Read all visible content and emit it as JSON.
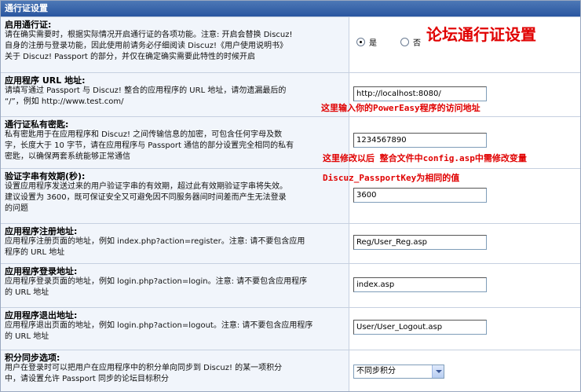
{
  "header": {
    "title": "通行证设置"
  },
  "rows": [
    {
      "title": "启用通行证:",
      "desc": [
        "请在确实需要时，根据实际情况开启通行证的各项功能。注意: 开启会替换 Discuz!",
        "自身的注册与登录功能，因此使用前请务必仔细阅读 Discuz!《用户使用说明书》",
        "关于 Discuz! Passport 的部分，并仅在确定确实需要此特性的时候开启"
      ],
      "options": [
        {
          "label": "是",
          "checked": true
        },
        {
          "label": "否",
          "checked": false
        }
      ]
    },
    {
      "title": "应用程序 URL 地址:",
      "desc": [
        "请填写通过 Passport 与 Discuz! 整合的应用程序的 URL 地址，请勿遗漏最后的",
        "“/”，例如 http://www.test.com/"
      ],
      "value": "http://localhost:8080/"
    },
    {
      "title": "通行证私有密匙:",
      "desc": [
        "私有密匙用于在应用程序和 Discuz! 之间传输信息的加密，可包含任何字母及数",
        "字，长度大于 10 字节，请在应用程序与 Passport 通信的部分设置完全相同的私有",
        "密匙，以确保两套系统能够正常通信"
      ],
      "value": "1234567890"
    },
    {
      "title": "验证字串有效期(秒):",
      "desc": [
        "设置应用程序发送过来的用户验证字串的有效期，超过此有效期验证字串将失效。",
        "建议设置为 3600，既可保证安全又可避免因不同服务器间时间差而产生无法登录",
        "的问题"
      ],
      "value": "3600"
    },
    {
      "title": "应用程序注册地址:",
      "desc": [
        "应用程序注册页面的地址，例如 index.php?action=register。注意: 请不要包含应用",
        "程序的 URL 地址"
      ],
      "value": "Reg/User_Reg.asp"
    },
    {
      "title": "应用程序登录地址:",
      "desc": [
        "应用程序登录页面的地址，例如 login.php?action=login。注意: 请不要包含应用程序",
        "的 URL 地址"
      ],
      "value": "index.asp"
    },
    {
      "title": "应用程序退出地址:",
      "desc": [
        "应用程序退出页面的地址，例如 login.php?action=logout。注意: 请不要包含应用程序",
        "的 URL 地址"
      ],
      "value": "User/User_Logout.asp"
    },
    {
      "title": "积分同步选项:",
      "desc": [
        "用户在登录时可以把用户在应用程序中的积分单向同步到 Discuz! 的某一项积分",
        "中，请设置允许 Passport 同步的论坛目标积分"
      ],
      "selected": "不同步积分"
    }
  ],
  "annotations": {
    "heading": "论坛通行证设置",
    "url_note": "这里输入你的PowerEasy程序的访问地址",
    "key_note": "这里修改以后 整合文件中config.asp中需修改变量",
    "key_note2": "Discuz_PassportKey为相同的值"
  },
  "colors": {
    "header": "#2a56a0",
    "annotation": "#e00000",
    "row_bg": "#f1f5fb"
  }
}
